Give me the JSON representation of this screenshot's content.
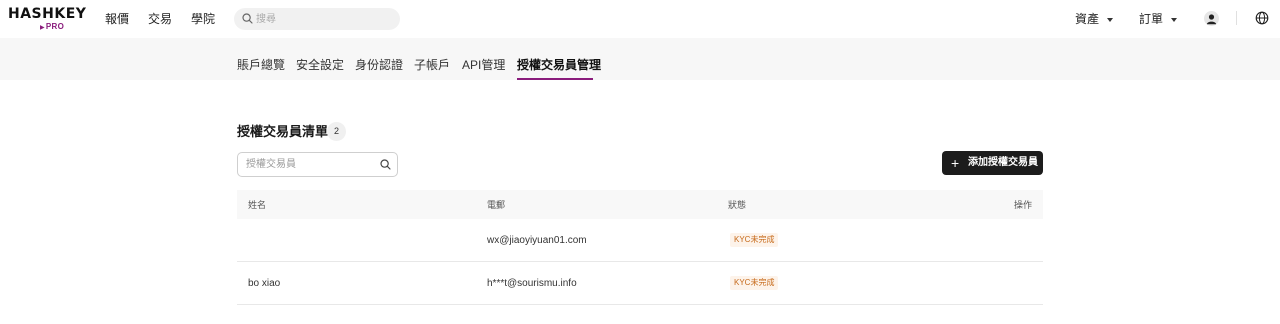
{
  "app": {
    "logo_main": "HASHKEY",
    "logo_sub": "PRO"
  },
  "topnav": {
    "items": [
      "報價",
      "交易",
      "學院"
    ]
  },
  "search": {
    "placeholder": "搜尋"
  },
  "rightmenu": {
    "assets": "資產",
    "orders": "訂單"
  },
  "tabs": [
    {
      "label": "賬戶總覽"
    },
    {
      "label": "安全設定"
    },
    {
      "label": "身份認證"
    },
    {
      "label": "子帳戶"
    },
    {
      "label": "API管理"
    },
    {
      "label": "授權交易員管理",
      "active": true
    }
  ],
  "section": {
    "title": "授權交易員清單",
    "count": "2"
  },
  "filter": {
    "placeholder": "授權交易員"
  },
  "add_button": {
    "label": "添加授權交易員"
  },
  "table": {
    "headers": {
      "name": "姓名",
      "email": "電郵",
      "status": "狀態",
      "action": "操作"
    },
    "rows": [
      {
        "name": "",
        "email": "wx@jiaoyiyuan01.com",
        "status": "KYC未完成"
      },
      {
        "name": "bo xiao",
        "email": "h***t@sourismu.info",
        "status": "KYC未完成"
      }
    ]
  },
  "colors": {
    "accent": "#8a1c7c",
    "button_bg": "#1c1c1c",
    "status_text": "#c66a1a"
  }
}
